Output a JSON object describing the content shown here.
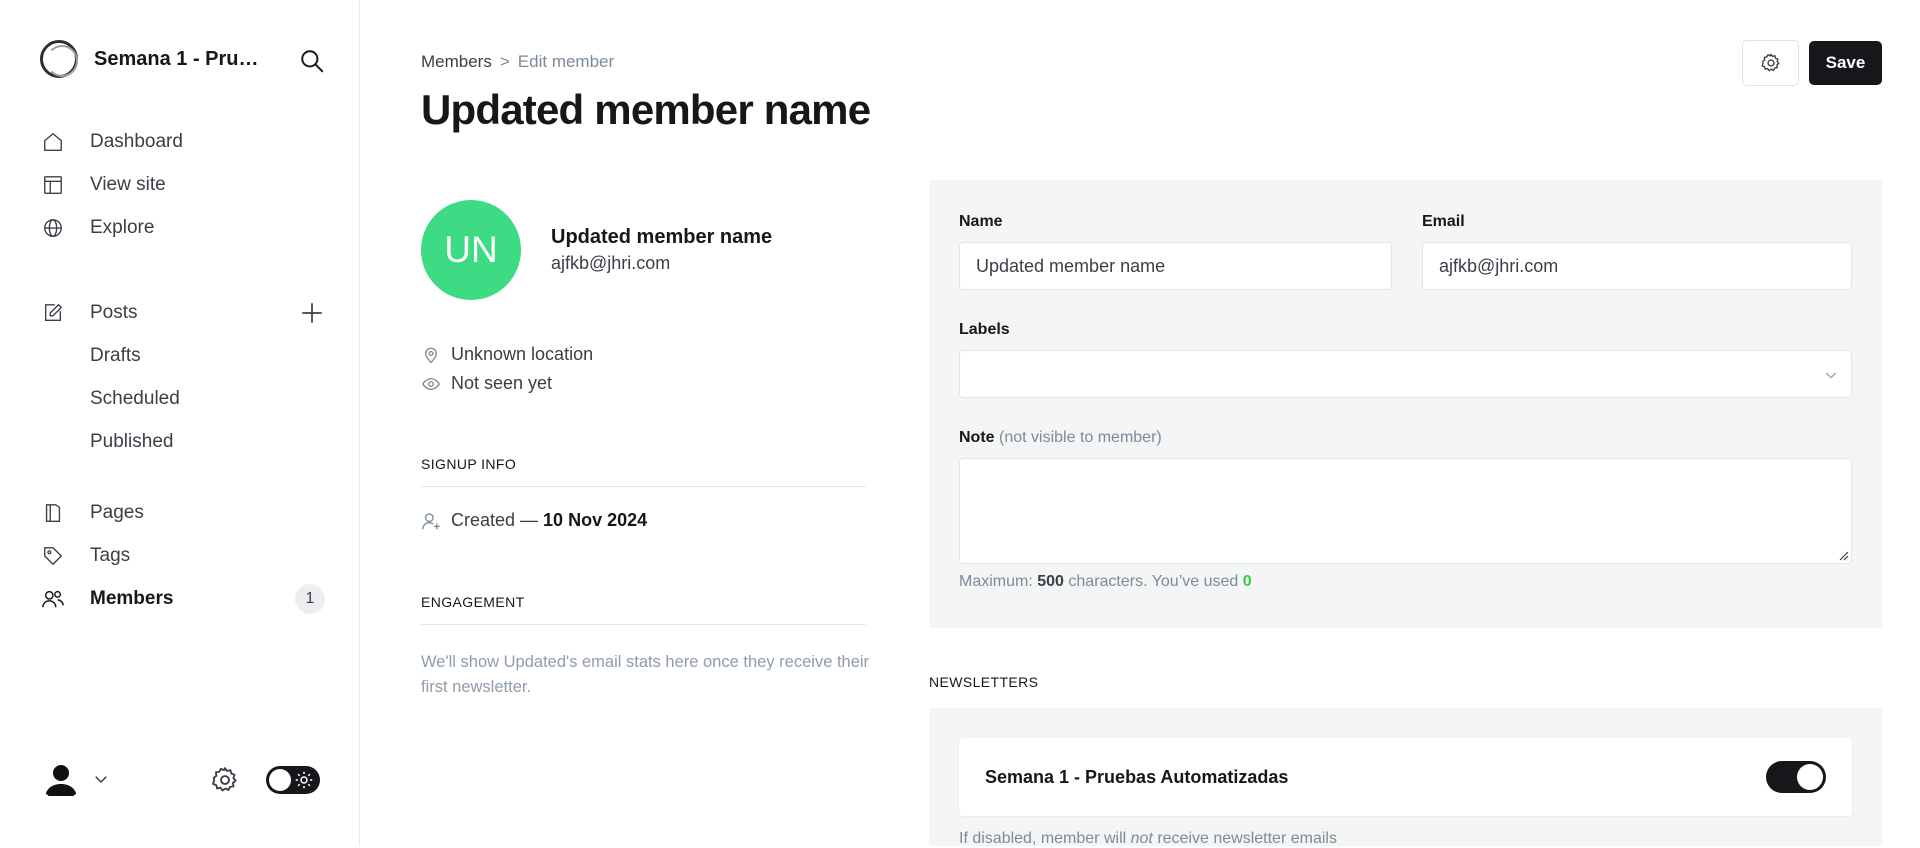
{
  "sidebar": {
    "site_title": "Semana 1 - Pruebas Automatizadas",
    "nav": {
      "dashboard": "Dashboard",
      "view_site": "View site",
      "explore": "Explore",
      "posts": "Posts",
      "drafts": "Drafts",
      "scheduled": "Scheduled",
      "published": "Published",
      "pages": "Pages",
      "tags": "Tags",
      "members": "Members",
      "members_count": "1"
    }
  },
  "header": {
    "breadcrumb_parent": "Members",
    "breadcrumb_separator": ">",
    "breadcrumb_current": "Edit member",
    "title": "Updated member name",
    "save_label": "Save"
  },
  "member": {
    "initials": "UN",
    "name": "Updated member name",
    "email": "ajfkb@jhri.com",
    "location": "Unknown location",
    "last_seen": "Not seen yet"
  },
  "signup": {
    "heading": "SIGNUP INFO",
    "created_prefix": "Created —",
    "created_date": "10 Nov 2024"
  },
  "engagement": {
    "heading": "ENGAGEMENT",
    "text": "We'll show Updated's email stats here once they receive their first newsletter."
  },
  "form": {
    "name_label": "Name",
    "name_value": "Updated member name",
    "email_label": "Email",
    "email_value": "ajfkb@jhri.com",
    "labels_label": "Labels",
    "labels_value": "",
    "note_label": "Note",
    "note_hint": "(not visible to member)",
    "note_value": "",
    "counter_prefix": "Maximum:",
    "counter_max": "500",
    "counter_mid": "characters. You’ve used",
    "counter_used": "0"
  },
  "newsletters": {
    "heading": "NEWSLETTERS",
    "items": [
      {
        "name": "Semana 1 - Pruebas Automatizadas",
        "enabled": true
      }
    ],
    "note_before": "If disabled, member will",
    "note_emph": "not",
    "note_after": "receive newsletter emails"
  },
  "colors": {
    "accent": "#15171a",
    "avatar_bg": "#3ddc84",
    "counter_used": "#30cf43",
    "panel_bg": "#f4f5f5"
  },
  "icons": [
    "search-icon",
    "home-icon",
    "layout-icon",
    "globe-icon",
    "edit-icon",
    "plus-icon",
    "pages-icon",
    "tag-icon",
    "members-icon",
    "chevron-down-icon",
    "gear-icon",
    "sun-icon",
    "location-icon",
    "eye-icon",
    "user-plus-icon"
  ]
}
